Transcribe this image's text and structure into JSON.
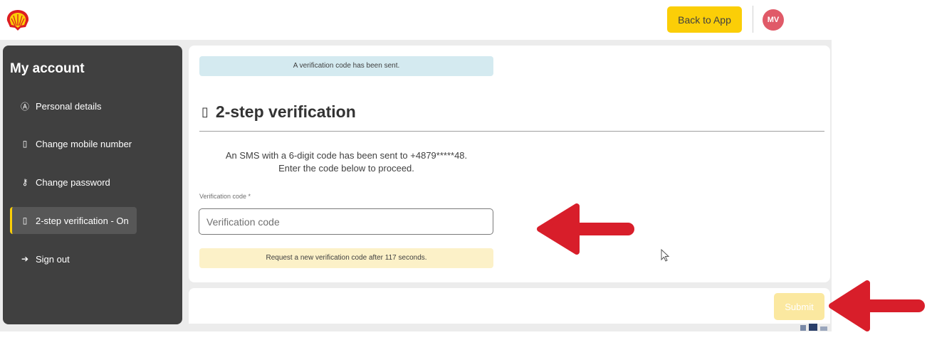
{
  "header": {
    "logo_icon": "shell-pecten-icon",
    "back_button": "Back to App",
    "avatar_initials": "MV"
  },
  "sidebar": {
    "title": "My account",
    "items": [
      {
        "label": "Personal details",
        "icon": "user-circle-icon",
        "glyph": "Ⓐ"
      },
      {
        "label": "Change mobile number",
        "icon": "mobile-phone-icon",
        "glyph": "▯"
      },
      {
        "label": "Change password",
        "icon": "key-icon",
        "glyph": "⚷"
      },
      {
        "label": "2-step verification - On",
        "icon": "mobile-phone-icon",
        "glyph": "▯",
        "active": true
      },
      {
        "label": "Sign out",
        "icon": "sign-out-icon",
        "glyph": "➔"
      }
    ]
  },
  "main": {
    "info_banner": "A verification code has been sent.",
    "title": "2-step verification",
    "sms_line1": "An SMS with a 6-digit code has been sent to +4879*****48.",
    "sms_line2": "Enter the code below to proceed.",
    "field_label": "Verification code *",
    "field_placeholder": "Verification code",
    "field_value": "",
    "warning_banner": "Request a new verification code after 117 seconds.",
    "submit_button": "Submit"
  },
  "colors": {
    "brand_yellow": "#fbce07",
    "sidebar_bg": "#404040",
    "info_banner_bg": "#d4eaf0",
    "warning_banner_bg": "#fcf1c8",
    "avatar_bg": "#e05a68",
    "annotation_arrow": "#d81e2a"
  }
}
